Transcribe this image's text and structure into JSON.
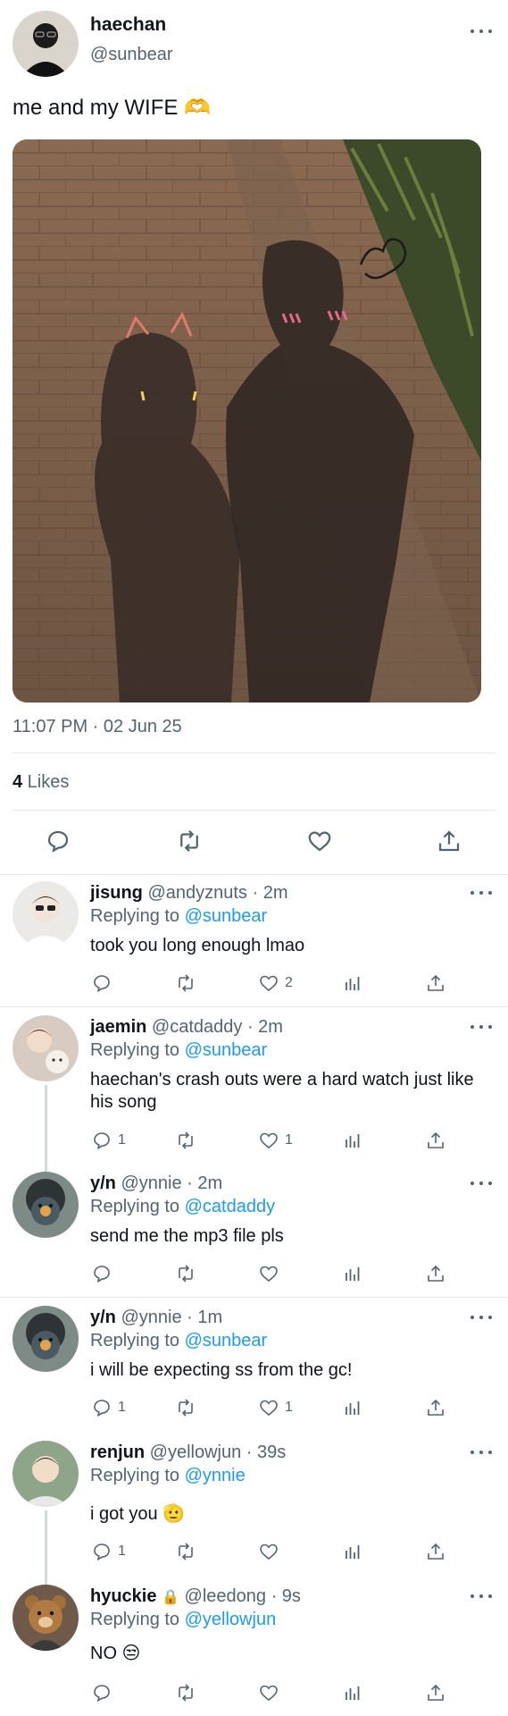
{
  "main": {
    "name": "haechan",
    "handle": "@sunbear",
    "text": "me and my WIFE 🫶",
    "timestamp": "11:07 PM · 02 Jun 25",
    "likes_count": "4",
    "likes_label": " Likes"
  },
  "replies": [
    {
      "name": "jisung",
      "meta": " @andyznuts · 2m",
      "replying_prefix": "Replying to ",
      "replying_to": "@sunbear",
      "text": "took you long enough lmao",
      "reply_count": "",
      "like_count": "2"
    },
    {
      "name": "jaemin",
      "meta": " @catdaddy · 2m",
      "replying_prefix": "Replying to ",
      "replying_to": "@sunbear",
      "text": "haechan's crash outs were a hard watch just like his song",
      "reply_count": "1",
      "like_count": "1"
    },
    {
      "name": "y/n",
      "meta": " @ynnie · 2m",
      "replying_prefix": "Replying to ",
      "replying_to": "@catdaddy",
      "text": "send me the mp3 file pls",
      "reply_count": "",
      "like_count": ""
    },
    {
      "name": "y/n",
      "meta": " @ynnie · 1m",
      "replying_prefix": "Replying to ",
      "replying_to": "@sunbear",
      "text": "i will be expecting ss from the gc!",
      "reply_count": "1",
      "like_count": "1"
    },
    {
      "name": "renjun",
      "meta": " @yellowjun · 39s",
      "replying_prefix": "Replying to ",
      "replying_to": "@ynnie",
      "text": "i got you 🫡",
      "reply_count": "1",
      "like_count": ""
    },
    {
      "name": "hyuckie",
      "lock": "🔒",
      "meta": " @leedong · 9s",
      "replying_prefix": "Replying to ",
      "replying_to": "@yellowjun",
      "text": "NO 😒",
      "reply_count": "",
      "like_count": ""
    }
  ],
  "colors": {
    "link": "#1d9bf0",
    "muted": "#536471",
    "divider": "#e4e8ea"
  },
  "icons": [
    "more-icon",
    "reply-icon",
    "retweet-icon",
    "like-icon",
    "views-icon",
    "share-icon",
    "lock-icon"
  ]
}
